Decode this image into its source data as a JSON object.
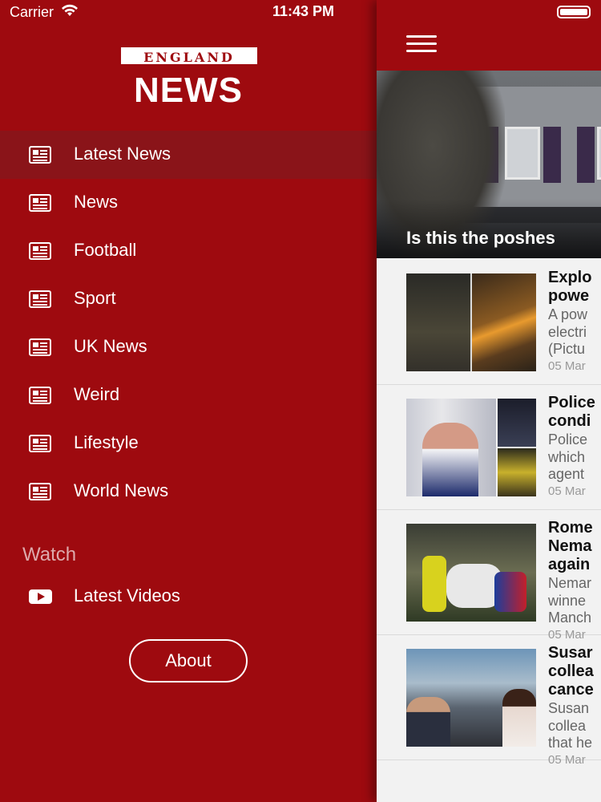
{
  "status_bar": {
    "carrier": "Carrier",
    "time": "11:43 PM"
  },
  "drawer": {
    "logo_top": "ENGLAND",
    "logo_bottom": "NEWS",
    "menu": [
      {
        "label": "Latest News",
        "icon": "newspaper-icon",
        "active": true
      },
      {
        "label": "News",
        "icon": "newspaper-icon"
      },
      {
        "label": "Football",
        "icon": "newspaper-icon"
      },
      {
        "label": "Sport",
        "icon": "newspaper-icon"
      },
      {
        "label": "UK News",
        "icon": "newspaper-icon"
      },
      {
        "label": "Weird",
        "icon": "newspaper-icon"
      },
      {
        "label": "Lifestyle",
        "icon": "newspaper-icon"
      },
      {
        "label": "World News",
        "icon": "newspaper-icon"
      }
    ],
    "watch_heading": "Watch",
    "video_item": {
      "label": "Latest Videos",
      "icon": "youtube-icon"
    },
    "about_label": "About"
  },
  "content": {
    "hero_caption": "Is this the poshes",
    "articles": [
      {
        "title": [
          "Explo",
          "powe"
        ],
        "snippet": [
          "A pow",
          "electri",
          "(Pictu"
        ],
        "date": "05 Mar"
      },
      {
        "title": [
          "Police",
          "condi"
        ],
        "snippet": [
          "Police",
          "which",
          "agent"
        ],
        "date": "05 Mar"
      },
      {
        "title": [
          "Rome",
          "Nema",
          "again"
        ],
        "snippet": [
          "Nemar",
          "winne",
          "Manch"
        ],
        "date": "05 Mar"
      },
      {
        "title": [
          "Susar",
          "collea",
          "cance"
        ],
        "snippet": [
          "Susan",
          "collea",
          "that he"
        ],
        "date": "05 Mar"
      }
    ]
  },
  "colors": {
    "brand_red": "#9e0a0f",
    "active_row": "#8a1419"
  }
}
